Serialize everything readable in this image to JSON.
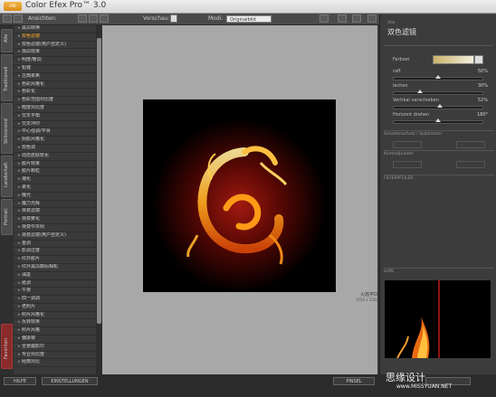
{
  "window": {
    "title": "Color Efex Pro™ 3.0",
    "logo_text": "nik"
  },
  "toolbar": {
    "ansichten_label": "Ansichten:",
    "vorschau_label": "Vorschau:",
    "modi_label": "Modi:",
    "modi_value": "Originalbild"
  },
  "left_tabs": [
    "Alle",
    "Traditionell",
    "Stilisierend",
    "Landschaft",
    "Portrait",
    "Favoriten"
  ],
  "filters": [
    "黑白转换",
    "双色滤镜",
    "双色滤镜(用户自定义)",
    "渐白效果",
    "明度/暖调",
    "铅锂",
    "古典柔焦",
    "色彩风格化",
    "色彩化",
    "色彩范围对比度",
    "暗度对比度",
    "交叉平衡",
    "交叉冲印",
    "中心强调/平滑",
    "阴影风格化",
    "双色调",
    "动态皮肤软化",
    "胶片效果",
    "胶片颗粒",
    "潮化",
    "柔化",
    "曝光",
    "魔力光辉",
    "渐变滤镜",
    "渐变雾化",
    "渐变中灰阴",
    "渐变滤镜(用户自定义)",
    "金调",
    "影调过度",
    "红外胶片",
    "红外黑白数码相机",
    "油墨",
    "纸调",
    "午夜",
    "四一调调",
    "老照片",
    "照片风格化",
    "反转效果",
    "照片风格",
    "偏振镖",
    "全景踮影印",
    "专业对比度",
    "经典对比"
  ],
  "selected_filter_index": 1,
  "preview": {
    "caption": "火焰字D",
    "caption_sub": "(550 x 550)"
  },
  "right_panel": {
    "category": "Alle",
    "filter_title": "双色滤镜",
    "farbset_label": "Farbset",
    "params": [
      {
        "label": "raft",
        "value": "50%",
        "fraction": 0.5
      },
      {
        "label": "lechen",
        "value": "30%",
        "fraction": 0.3
      },
      {
        "label": "Vertikal verschieben",
        "value": "52%",
        "fraction": 0.52
      },
      {
        "label": "Horizont drehen",
        "value": "180°",
        "fraction": 0.5
      }
    ],
    "schatten_label": "Schattenschutz / Spitzlichter",
    "kontroll_label": "Kontrollpunkte",
    "filterpfeiler_label": "FILTERPFEILER",
    "lupe_label": "LUPE"
  },
  "bottom": {
    "hilfe": "HILFE",
    "einstellungen": "EINSTELLUNGEN",
    "pinsel": "PINSEL"
  },
  "watermark": {
    "line1": "思缘设计",
    "line2": "www.MISSYUAN.NET"
  },
  "colors": {
    "accent": "#ffae2e",
    "favorites": "#8a2a2a"
  }
}
